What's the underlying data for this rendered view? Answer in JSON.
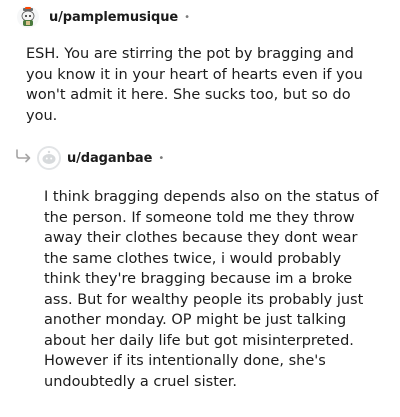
{
  "parent_comment": {
    "username": "u/pamplemusique",
    "meta_dot": "•",
    "avatar_icon": "snoo-avatar-icon",
    "body": "ESH. You are stirring the pot by bragging and you know it in your heart of hearts even if you won't admit it here. She sucks too, but so do you."
  },
  "reply_comment": {
    "username": "u/daganbae",
    "meta_dot": "•",
    "avatar_icon": "default-avatar-icon",
    "reply_icon": "reply-arrow-icon",
    "body": "I think bragging depends also on the status of the person. If someone told me they throw away their clothes because they dont wear the same clothes twice, i would probably think they're bragging because im a broke ass. But for wealthy people its probably just another monday. OP might be just talking about her daily life but got misinterpreted. However if its intentionally done, she's undoubtedly a cruel sister."
  },
  "colors": {
    "text": "#1c1c1c",
    "meta": "#7c7c7c",
    "reply_arrow": "#a5a4a4",
    "avatar_border": "#e2e4e6"
  }
}
